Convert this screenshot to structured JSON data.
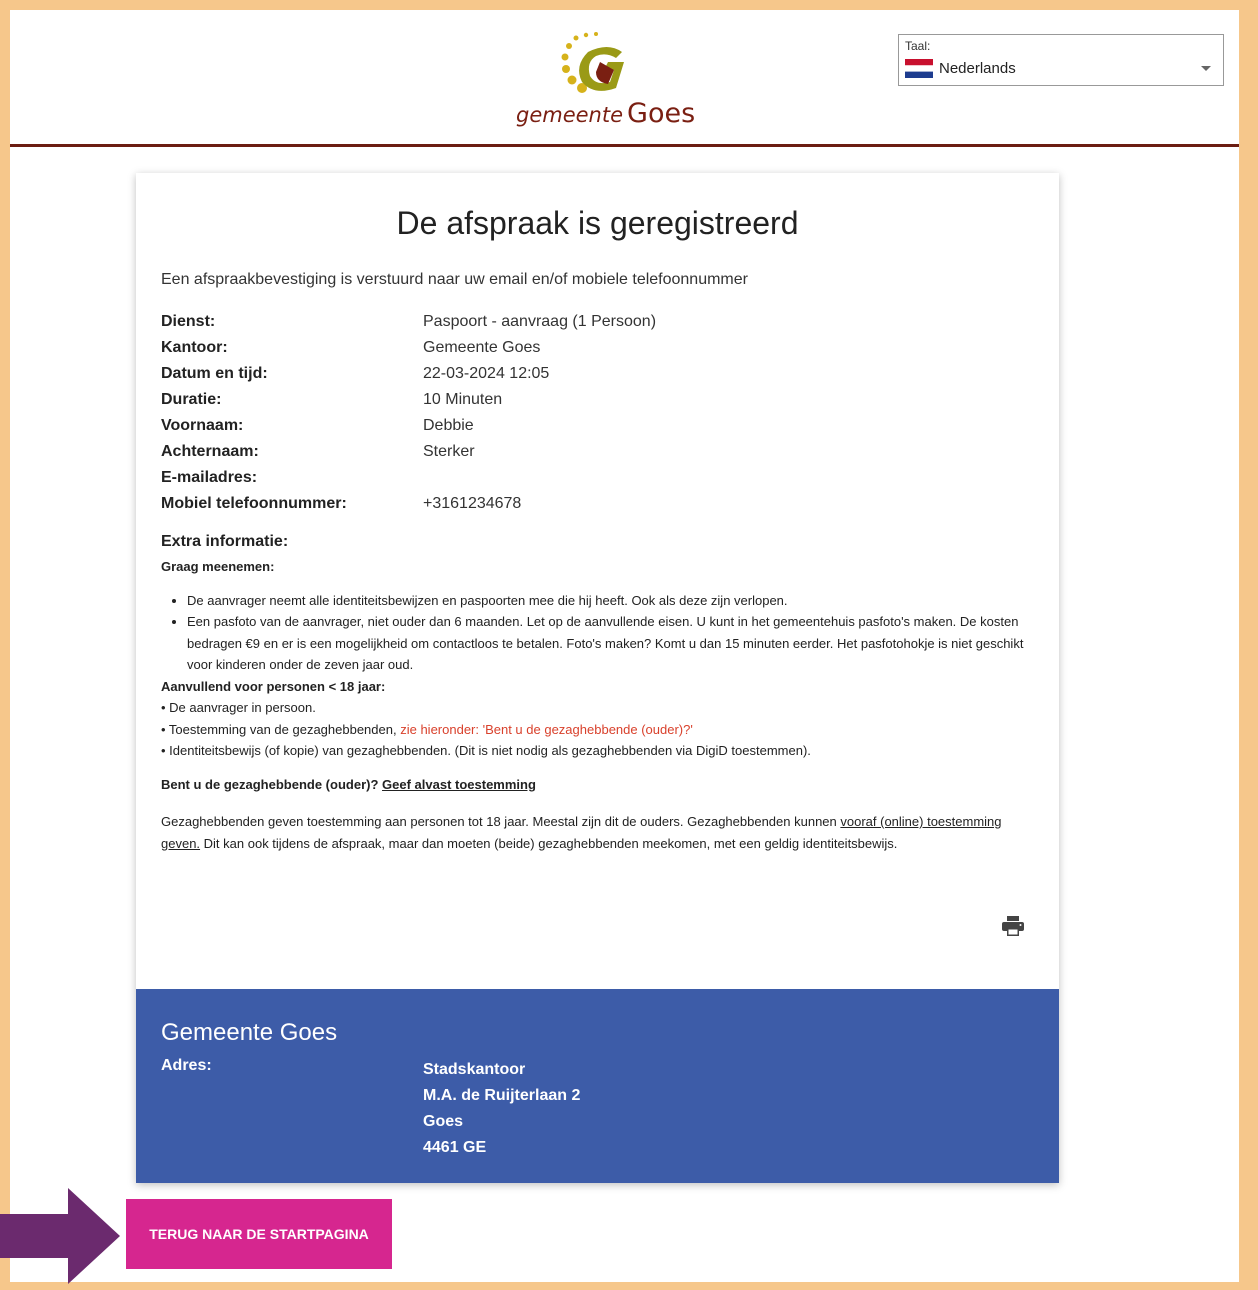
{
  "header": {
    "logo": {
      "prefix": "gemeente",
      "name": "Goes"
    },
    "language": {
      "label": "Taal:",
      "value": "Nederlands",
      "flag": "netherlands-flag"
    }
  },
  "card": {
    "title": "De afspraak is geregistreerd",
    "intro": "Een afspraakbevestiging is verstuurd naar uw email en/of mobiele telefoonnummer",
    "details": [
      {
        "label": "Dienst:",
        "value": "Paspoort - aanvraag (1 Persoon)"
      },
      {
        "label": "Kantoor:",
        "value": "Gemeente Goes"
      },
      {
        "label": "Datum en tijd:",
        "value": "22-03-2024 12:05"
      },
      {
        "label": "Duratie:",
        "value": "10 Minuten"
      },
      {
        "label": "Voornaam:",
        "value": "Debbie"
      },
      {
        "label": "Achternaam:",
        "value": "Sterker"
      },
      {
        "label": "E-mailadres:",
        "value": ""
      },
      {
        "label": "Mobiel telefoonnummer:",
        "value": "+3161234678"
      }
    ],
    "extra": {
      "title": "Extra informatie:",
      "subtitle": "Graag meenemen:",
      "bullets": [
        "De aanvrager neemt alle identiteitsbewijzen en paspoorten mee die hij heeft. Ook als deze zijn verlopen.",
        "Een pasfoto van de aanvrager, niet ouder dan 6 maanden. Let op de aanvullende eisen. U kunt in het gemeentehuis pasfoto's maken. De kosten bedragen €9 en er is een mogelijkheid om contactloos te betalen. Foto's maken? Komt u dan 15 minuten eerder. Het pasfotohokje is niet geschikt voor kinderen onder de zeven jaar oud."
      ],
      "minors_title": "Aanvullend voor personen < 18 jaar:",
      "minors_1": "• De aanvrager in persoon.",
      "minors_2_prefix": "• Toestemming van de gezaghebbenden, ",
      "minors_2_link": "zie hieronder: 'Bent u de gezaghebbende (ouder)?'",
      "minors_3": "• Identiteitsbewijs (of kopie) van gezaghebbenden. (Dit is niet nodig als gezaghebbenden via DigiD toestemmen).",
      "guardian_question": "Bent u de gezaghebbende (ouder)?",
      "guardian_link": "Geef alvast toestemming",
      "guardian_text_1": "Gezaghebbenden geven toestemming aan personen tot 18 jaar. Meestal zijn dit de ouders. Gezaghebbenden kunnen ",
      "guardian_text_link": "vooraf (online) toestemming geven.",
      "guardian_text_2": " Dit kan ook tijdens de afspraak, maar dan moeten (beide) gezaghebbenden meekomen, met een geldig identiteitsbewijs."
    },
    "print_icon": "printer-icon"
  },
  "footer": {
    "name": "Gemeente Goes",
    "address_label": "Adres:",
    "address_lines": [
      "Stadskantoor",
      "M.A. de Ruijterlaan 2",
      "Goes",
      "4461 GE"
    ]
  },
  "back_button": {
    "label": "TERUG NAAR DE STARTPAGINA"
  },
  "colors": {
    "outer_background": "#f6c78b",
    "header_rule": "#6b1d12",
    "footer_background": "#3d5ca8",
    "button_background": "#d6268f",
    "link_red": "#d9412c",
    "arrow": "#6b2a6e"
  }
}
